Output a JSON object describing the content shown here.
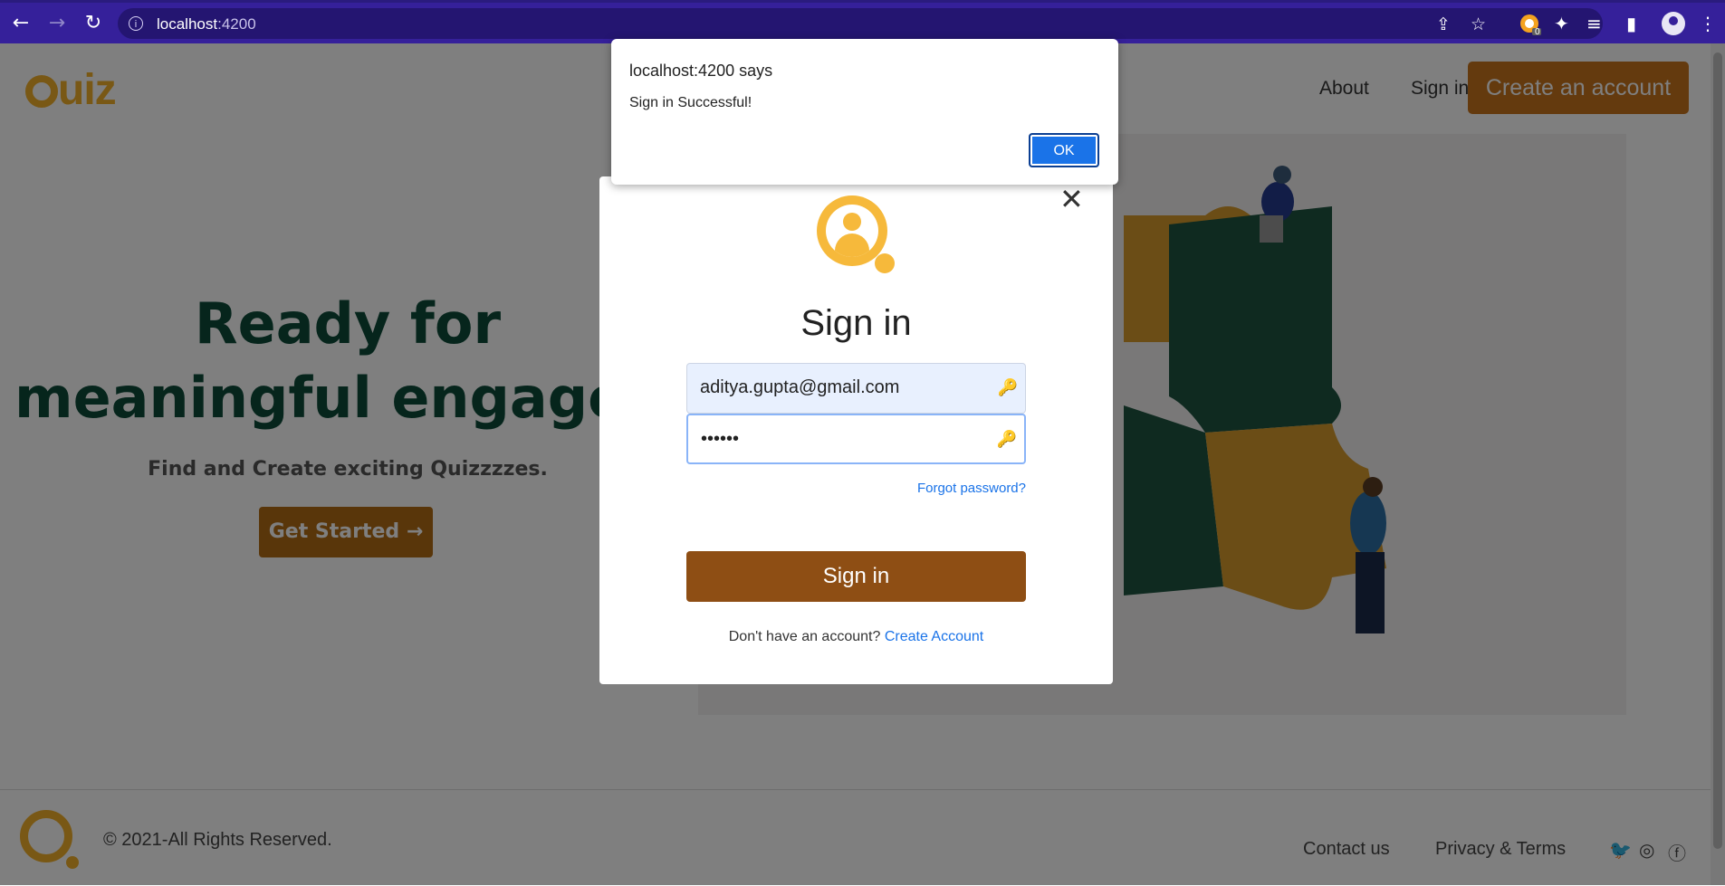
{
  "browser": {
    "url_host": "localhost",
    "url_port": ":4200",
    "extension_badge": "0"
  },
  "navbar": {
    "logo_text": "uiz",
    "links": [
      {
        "label": "About"
      },
      {
        "label": "Sign in"
      }
    ],
    "cta_label": "Create an account"
  },
  "hero": {
    "title_line1": "Ready for",
    "title_line2": "meaningful engageme",
    "subtitle": "Find and Create exciting Quizzzzes.",
    "button_label": "Get Started",
    "button_arrow": "→"
  },
  "footer": {
    "copyright": "© 2021-All Rights Reserved.",
    "links": [
      {
        "label": "Contact us"
      },
      {
        "label": "Privacy & Terms"
      }
    ]
  },
  "modal": {
    "close": "✕",
    "title": "Sign in",
    "email_value": "aditya.gupta@gmail.com",
    "password_value": "••••••",
    "forgot_label": "Forgot password?",
    "submit_label": "Sign in",
    "signup_prompt": "Don't have an account?",
    "signup_link": "Create Account"
  },
  "alert": {
    "title": "localhost:4200 says",
    "message": "Sign in Successful!",
    "ok_label": "OK"
  },
  "colors": {
    "brand_orange": "#c8741c",
    "logo_yellow": "#f2b02b",
    "hero_green": "#0c4a38",
    "chrome_purple": "#35209a"
  }
}
